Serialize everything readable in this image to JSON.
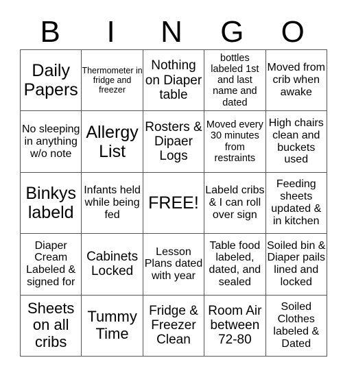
{
  "header": {
    "letters": [
      "B",
      "I",
      "N",
      "G",
      "O"
    ]
  },
  "board": {
    "rows": [
      [
        "Daily Papers",
        "Thermometer in fridge and freezer",
        "Nothing on Diaper table",
        "bottles labeled 1st and last name and dated",
        "Moved from crib when awake"
      ],
      [
        "No sleeping in anything w/o note",
        "Allergy List",
        "Rosters & Dipaer Logs",
        "Moved every 30 minutes from restraints",
        "High chairs clean and buckets used"
      ],
      [
        "Binkys labeld",
        "Infants held while being fed",
        "FREE!",
        "Labeld cribs & I can roll over sign",
        "Feeding sheets updated & in kitchen"
      ],
      [
        "Diaper Cream Labeled & signed for",
        "Cabinets Locked",
        "Lesson Plans dated with year",
        "Table food labeled, dated, and sealed",
        "Soiled bin & Diaper pails lined and locked"
      ],
      [
        "Sheets on all cribs",
        "Tummy Time",
        "Fridge & Freezer Clean",
        "Room Air between 72-80",
        "Soiled Clothes labeled & Dated"
      ]
    ]
  }
}
